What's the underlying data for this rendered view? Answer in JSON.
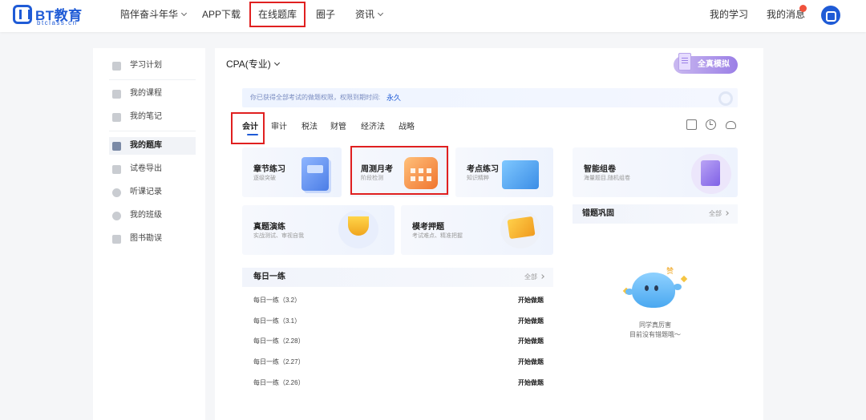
{
  "header": {
    "brand": "BT教育",
    "brand_sub": "btclass.cn",
    "nav": [
      {
        "label": "陪伴奋斗年华",
        "has_dropdown": true
      },
      {
        "label": "APP下载",
        "has_dropdown": false
      },
      {
        "label": "在线题库",
        "has_dropdown": false,
        "highlighted": true
      },
      {
        "label": "圈子",
        "has_dropdown": false
      },
      {
        "label": "资讯",
        "has_dropdown": true
      }
    ],
    "my_study": "我的学习",
    "my_messages": "我的消息",
    "message_badge_color": "#f0523c"
  },
  "sidebar": {
    "items": [
      {
        "label": "学习计划",
        "icon": "calendar-icon"
      },
      {
        "label": "我的课程",
        "icon": "play-icon"
      },
      {
        "label": "我的笔记",
        "icon": "notes-icon"
      },
      {
        "label": "我的题库",
        "icon": "question-bank-icon",
        "active": true
      },
      {
        "label": "试卷导出",
        "icon": "export-icon"
      },
      {
        "label": "听课记录",
        "icon": "history-icon"
      },
      {
        "label": "我的班级",
        "icon": "class-icon"
      },
      {
        "label": "图书勘误",
        "icon": "book-icon"
      }
    ]
  },
  "main": {
    "exam": "CPA(专业)",
    "mock_button": "全真模拟",
    "notice_text": "你已获得全部考试的做题权限，权限到期时间:",
    "notice_value": "永久",
    "subjects": [
      {
        "label": "会计",
        "active": true
      },
      {
        "label": "审计"
      },
      {
        "label": "税法"
      },
      {
        "label": "财管"
      },
      {
        "label": "经济法"
      },
      {
        "label": "战略"
      }
    ],
    "cards": [
      {
        "title": "章节练习",
        "subtitle": "逐级突破",
        "icon": "book-icon"
      },
      {
        "title": "周测月考",
        "subtitle": "阶段检测",
        "icon": "calendar-icon",
        "highlighted": true
      },
      {
        "title": "考点练习",
        "subtitle": "知识精粹",
        "icon": "folder-icon"
      },
      {
        "title": "真题演练",
        "subtitle": "实战测试、审视自我",
        "icon": "trophy-icon"
      },
      {
        "title": "模考押题",
        "subtitle": "考试难点、精准把握",
        "icon": "flag-icon"
      },
      {
        "title": "智能组卷",
        "subtitle": "海量题目,随机组卷",
        "icon": "paper-icon"
      }
    ],
    "daily": {
      "title": "每日一练",
      "all_label": "全部",
      "rows": [
        {
          "name": "每日一练（3.2）",
          "action": "开始做题"
        },
        {
          "name": "每日一练（3.1）",
          "action": "开始做题"
        },
        {
          "name": "每日一练（2.28）",
          "action": "开始做题"
        },
        {
          "name": "每日一练（2.27）",
          "action": "开始做题"
        },
        {
          "name": "每日一练（2.26）",
          "action": "开始做题"
        }
      ]
    },
    "wrong": {
      "title": "错题巩固",
      "all_label": "全部",
      "badge": "赞",
      "empty_line1": "同学真厉害",
      "empty_line2": "目前没有错题哦～"
    }
  },
  "colors": {
    "brand_blue": "#1f5bd6",
    "highlight_red": "#e02020"
  }
}
